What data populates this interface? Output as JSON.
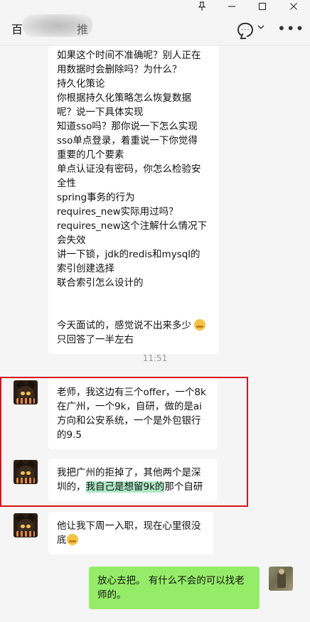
{
  "window": {
    "pin_icon": "pin-icon",
    "minimize_icon": "minimize-icon",
    "maximize_icon": "maximize-icon",
    "close_icon": "close-icon"
  },
  "header": {
    "title_prefix": "百",
    "title_suffix": "推"
  },
  "messages": {
    "m1": "如果这个时间不准确呢？别人正在\n用数据时会删除吗？为什么？\n持久化策论\n你根据持久化策略怎么恢复数据\n呢？说一下具体实现\n知道sso吗？那你说一下怎么实现\nsso单点登录，着重说一下你觉得\n重要的几个要素\n单点认证没有密码，你怎么检验安\n全性\nspring事务的行为\nrequires_new实际用过吗？\nrequires_new这个注解什么情况下\n会失效\n讲一下锁，jdk的redis和mysql的\n索引创建选择\n联合索引怎么设计的\n\n\n今天面试的，感觉说不出来多少",
    "m1_tail": "\n只回答了一半左右",
    "time": "11:51",
    "m2": "老师，我这边有三个offer，一个8k\n在广州，一个9k，自研，做的是ai\n方向和公安系统，一个是外包银行\n的9.5",
    "m3_a": "我把广州的拒掉了，其他两个是深\n圳的，",
    "m3_hl": "我自己是想留9k的",
    "m3_b": "那个自研",
    "m4": "他让我下周一入职，现在心里很没\n底",
    "m5": "放心去把。 有什么不会的可以找老\n师的。"
  }
}
